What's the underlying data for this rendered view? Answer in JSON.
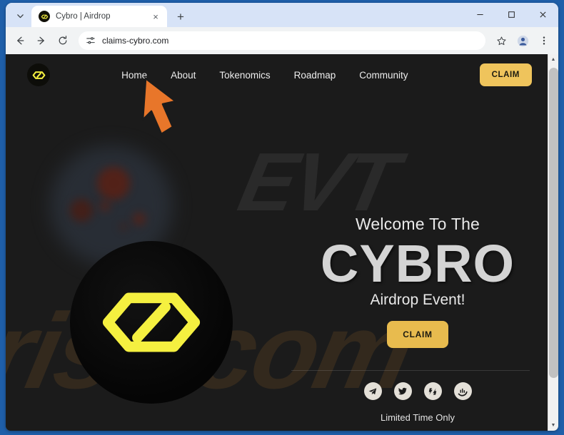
{
  "browser": {
    "tab": {
      "title": "Cybro | Airdrop",
      "favicon": "cybro-logo-icon"
    },
    "new_tab_label": "+",
    "close_tab_label": "×",
    "window_controls": {
      "minimize": "—",
      "maximize": "□",
      "close": "✕"
    },
    "toolbar": {
      "back": "back-arrow-icon",
      "forward": "forward-arrow-icon",
      "reload": "reload-icon",
      "site_settings": "tune-icon",
      "url": "claims-cybro.com",
      "bookmark": "star-icon",
      "profile": "profile-avatar-icon",
      "menu": "three-dot-menu-icon"
    }
  },
  "page": {
    "header": {
      "logo": "cybro-logo-icon",
      "nav": [
        {
          "label": "Home"
        },
        {
          "label": "About"
        },
        {
          "label": "Tokenomics"
        },
        {
          "label": "Roadmap"
        },
        {
          "label": "Community"
        }
      ],
      "claim_label": "CLAIM"
    },
    "hero": {
      "logo": "cybro-hexagon-logo",
      "welcome": "Welcome To The",
      "title": "CYBRO",
      "subtitle": "Airdrop Event!",
      "claim_label": "CLAIM",
      "limited": "Limited Time Only",
      "socials": [
        {
          "name": "telegram-icon"
        },
        {
          "name": "twitter-icon"
        },
        {
          "name": "zealy-icon"
        },
        {
          "name": "chart-icon"
        }
      ]
    },
    "watermark": {
      "top": "EVT",
      "bottom": "risk.com"
    }
  },
  "colors": {
    "accent_gold": "#efc45c",
    "logo_yellow": "#f5f040",
    "page_bg": "#1b1b1b",
    "annotation_orange": "#e8762a"
  },
  "scrollbar": {
    "up": "▲",
    "down": "▼"
  }
}
